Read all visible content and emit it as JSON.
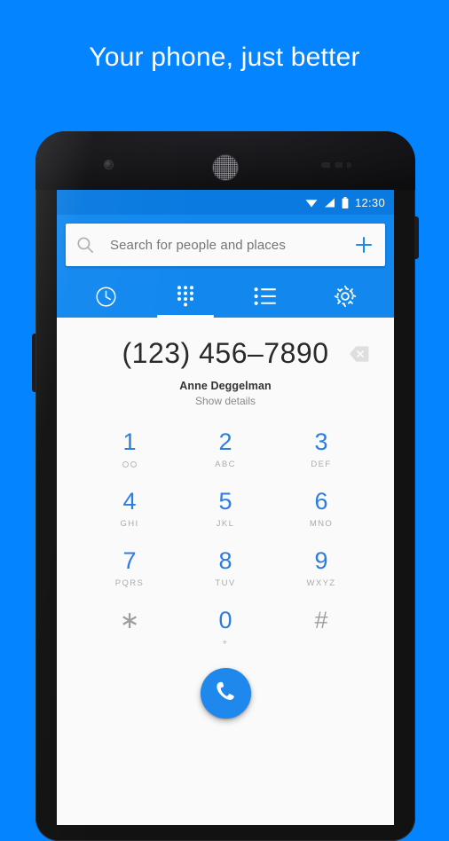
{
  "headline": "Your phone, just better",
  "colors": {
    "background_blue": "#0584ff",
    "appbar_blue": "#1288ef",
    "statusbar_blue": "#0a7ae0",
    "digit_blue": "#2b7de0",
    "fab_blue": "#1e88ec",
    "sublabel_gray": "#ababab"
  },
  "statusbar": {
    "wifi_icon": "wifi-icon",
    "signal_icon": "signal-icon",
    "battery_icon": "battery-icon",
    "time": "12:30"
  },
  "search": {
    "icon": "search-icon",
    "placeholder": "Search for people and places",
    "value": "",
    "add_icon": "plus-icon"
  },
  "tabs": [
    {
      "name": "recents",
      "icon": "clock-icon",
      "active": false
    },
    {
      "name": "dialpad",
      "icon": "dialpad-icon",
      "active": true
    },
    {
      "name": "contacts",
      "icon": "list-icon",
      "active": false
    },
    {
      "name": "settings",
      "icon": "gear-icon",
      "active": false
    }
  ],
  "dialer": {
    "number": "(123) 456–7890",
    "backspace_icon": "backspace-icon",
    "contact_name": "Anne Deggelman",
    "show_details": "Show details",
    "call_icon": "phone-icon"
  },
  "keypad": [
    [
      {
        "digit": "1",
        "sub": "",
        "sub_icon": "voicemail-icon",
        "muted": false
      },
      {
        "digit": "2",
        "sub": "ABC",
        "sub_icon": "",
        "muted": false
      },
      {
        "digit": "3",
        "sub": "DEF",
        "sub_icon": "",
        "muted": false
      }
    ],
    [
      {
        "digit": "4",
        "sub": "GHI",
        "sub_icon": "",
        "muted": false
      },
      {
        "digit": "5",
        "sub": "JKL",
        "sub_icon": "",
        "muted": false
      },
      {
        "digit": "6",
        "sub": "MNO",
        "sub_icon": "",
        "muted": false
      }
    ],
    [
      {
        "digit": "7",
        "sub": "PQRS",
        "sub_icon": "",
        "muted": false
      },
      {
        "digit": "8",
        "sub": "TUV",
        "sub_icon": "",
        "muted": false
      },
      {
        "digit": "9",
        "sub": "WXYZ",
        "sub_icon": "",
        "muted": false
      }
    ],
    [
      {
        "digit": "∗",
        "sub": "",
        "sub_icon": "",
        "muted": true
      },
      {
        "digit": "0",
        "sub": "+",
        "sub_icon": "",
        "muted": false
      },
      {
        "digit": "#",
        "sub": "",
        "sub_icon": "",
        "muted": true
      }
    ]
  ],
  "device": {
    "camera_icon": "front-camera-icon",
    "earpiece_icon": "earpiece-speaker-icon",
    "sensor_icon": "proximity-sensor-icon",
    "volume_button": "volume-button",
    "power_button": "power-button"
  }
}
